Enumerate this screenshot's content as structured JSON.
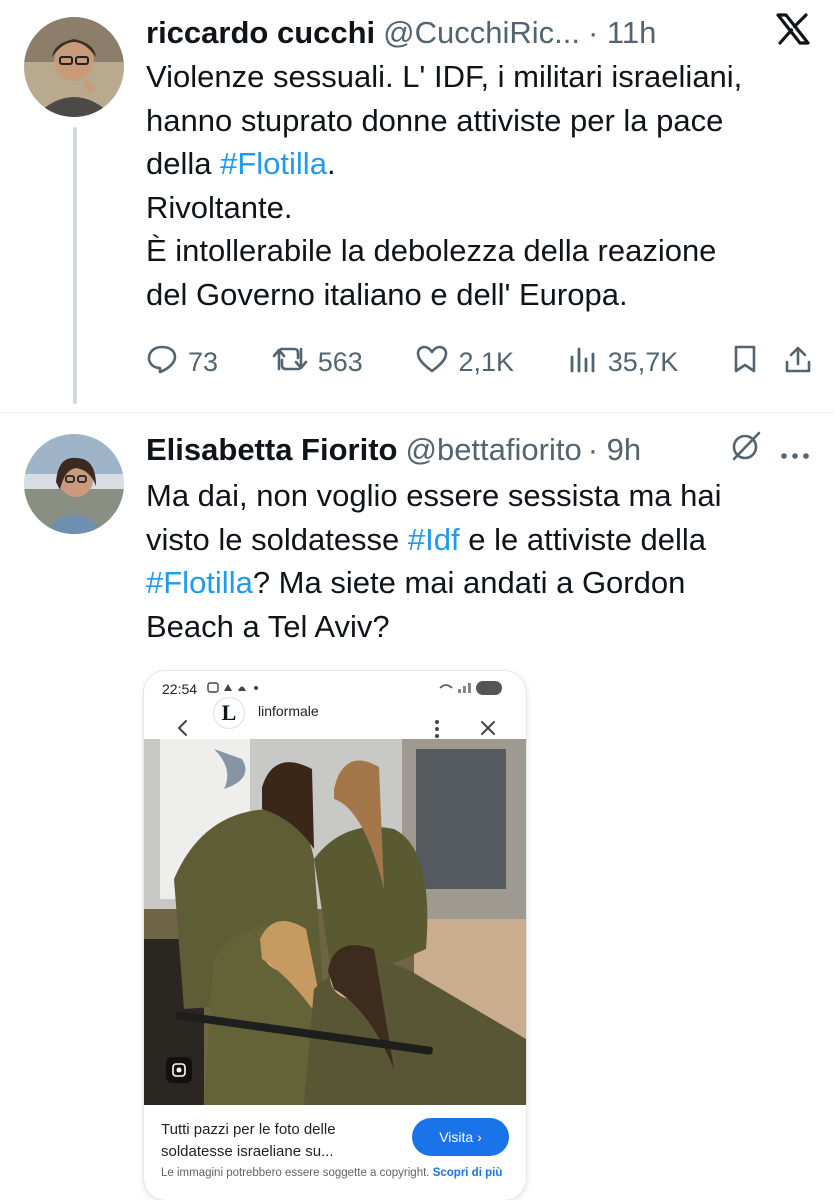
{
  "tweet1": {
    "name": "riccardo cucchi",
    "handle": "@CucchiRic...",
    "dot_time": "· 11h",
    "text_lines": [
      "Violenze sessuali. L' IDF, i militari israeliani,",
      "hanno stuprato donne attiviste per la pace",
      "della ",
      "#Flotilla",
      ".",
      "Rivoltante.",
      "È intollerabile la debolezza della reazione",
      "del Governo italiano e dell' Europa."
    ],
    "replies": "73",
    "retweets": "563",
    "likes": "2,1K",
    "views": "35,7K"
  },
  "tweet2": {
    "name": "Elisabetta Fiorito",
    "handle": "@bettafiorito",
    "dot_time": "· 9h",
    "text_lines": [
      "Ma dai, non voglio essere sessista ma hai",
      "visto le soldatesse ",
      "#Idf",
      " e le attiviste della",
      "#Flotilla",
      "? Ma siete mai andati a Gordon",
      "Beach a Tel Aviv?"
    ]
  },
  "embedded": {
    "time": "22:54",
    "site_logo": "L",
    "site_name": "linformale",
    "caption": "Tutti pazzi per le foto delle soldatesse israeliane su...",
    "visit_label": "Visita ›",
    "copyright": "Le immagini potrebbero essere soggette a copyright.",
    "learn_more": "Scopri di più"
  },
  "colors": {
    "accent": "#1d9bf0",
    "muted": "#536471",
    "text": "#0f1419",
    "google_blue": "#1a73e8"
  },
  "icons": [
    "x-logo-icon",
    "reply-icon",
    "retweet-icon",
    "like-icon",
    "views-icon",
    "bookmark-icon",
    "share-icon",
    "grok-icon",
    "more-icon",
    "lens-icon"
  ]
}
